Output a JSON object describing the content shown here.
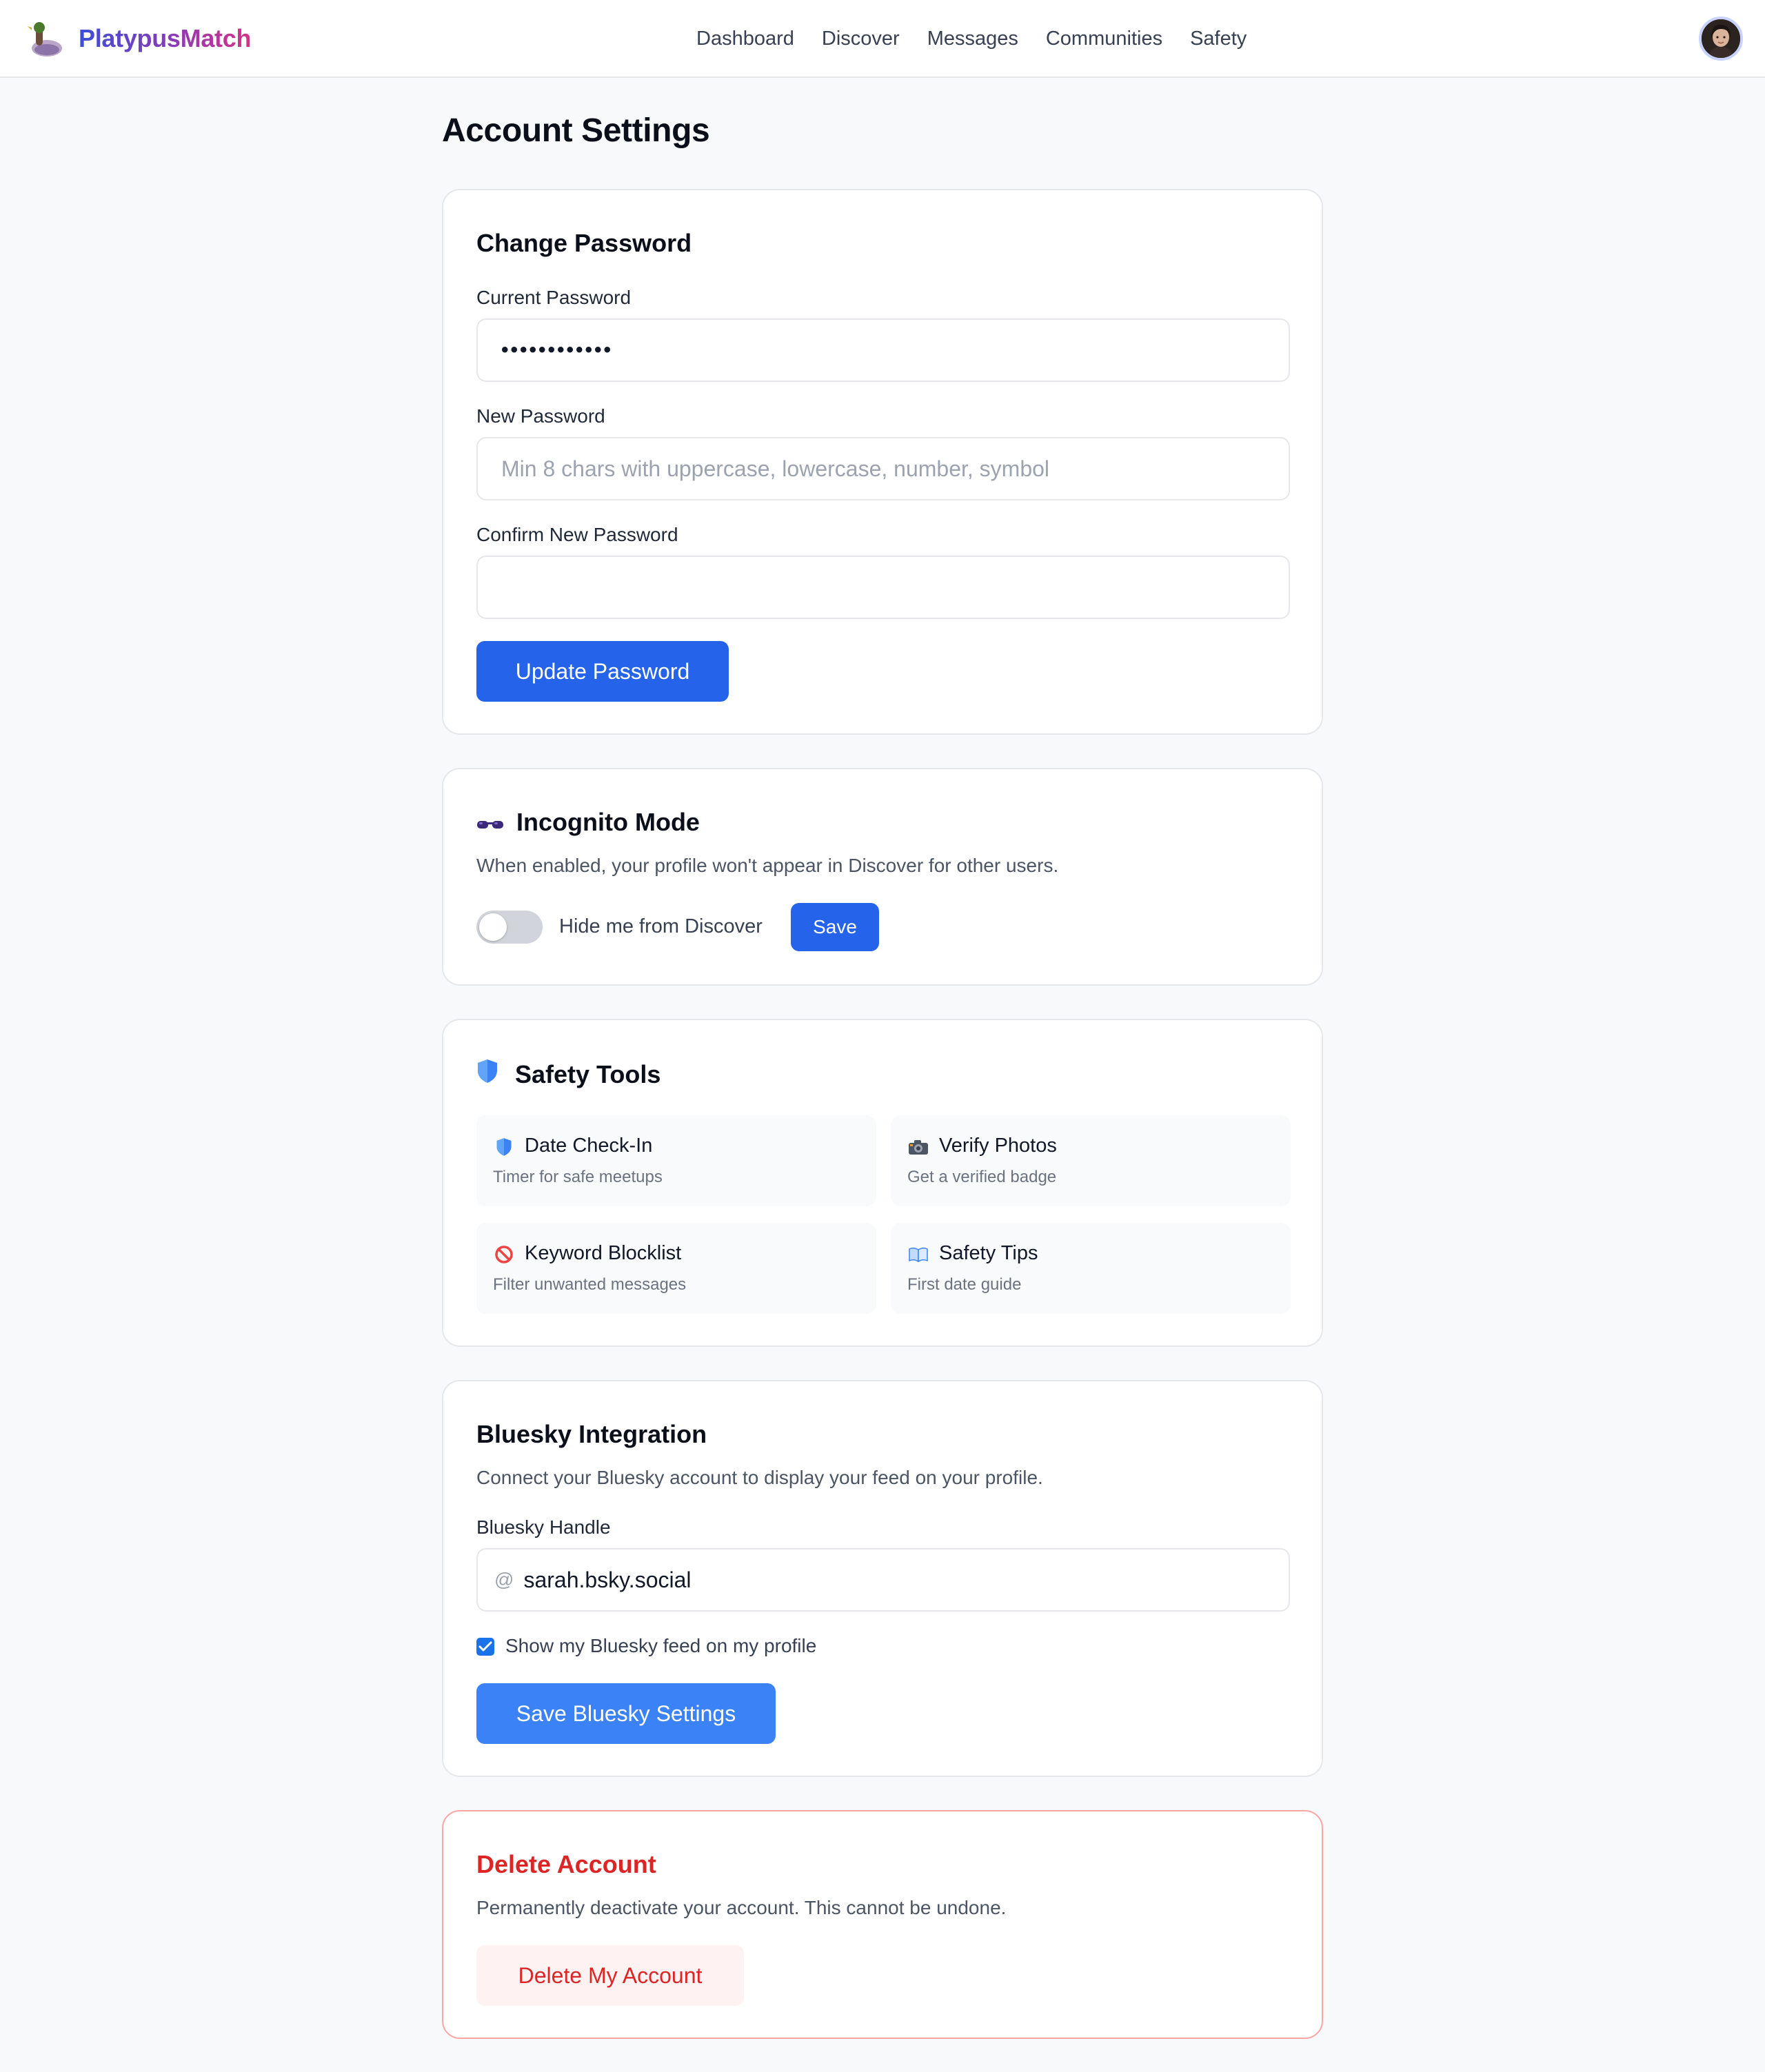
{
  "app": {
    "brand": "PlatypusMatch",
    "brand_gradient": [
      "#3b4fd6",
      "#d63384"
    ],
    "logo_icon": "platypus-duck-icon"
  },
  "nav": {
    "items": [
      "Dashboard",
      "Discover",
      "Messages",
      "Communities",
      "Safety"
    ]
  },
  "user": {
    "avatar_icon": "user-avatar"
  },
  "page": {
    "title": "Account Settings"
  },
  "change_password": {
    "title": "Change Password",
    "current_label": "Current Password",
    "current_value": "••••••••••••",
    "new_label": "New Password",
    "new_placeholder": "Min 8 chars with uppercase, lowercase, number, symbol",
    "confirm_label": "Confirm New Password",
    "confirm_value": "",
    "button": "Update Password"
  },
  "incognito": {
    "icon": "sunglasses-icon",
    "title": "Incognito Mode",
    "description": "When enabled, your profile won't appear in Discover for other users.",
    "toggle_label": "Hide me from Discover",
    "toggle_on": false,
    "button": "Save"
  },
  "safety_tools": {
    "icon": "shield-icon",
    "title": "Safety Tools",
    "tiles": [
      {
        "icon": "shield-icon",
        "title": "Date Check-In",
        "subtitle": "Timer for safe meetups"
      },
      {
        "icon": "camera-icon",
        "title": "Verify Photos",
        "subtitle": "Get a verified badge"
      },
      {
        "icon": "prohibited-icon",
        "title": "Keyword Blocklist",
        "subtitle": "Filter unwanted messages"
      },
      {
        "icon": "book-icon",
        "title": "Safety Tips",
        "subtitle": "First date guide"
      }
    ]
  },
  "bluesky": {
    "title": "Bluesky Integration",
    "description": "Connect your Bluesky account to display your feed on your profile.",
    "handle_label": "Bluesky Handle",
    "handle_prefix": "@",
    "handle_value": "sarah.bsky.social",
    "show_feed_label": "Show my Bluesky feed on my profile",
    "show_feed_checked": true,
    "button": "Save Bluesky Settings"
  },
  "delete_account": {
    "title": "Delete Account",
    "description": "Permanently deactivate your account. This cannot be undone.",
    "button": "Delete My Account"
  },
  "colors": {
    "primary": "#2563eb",
    "primary_light": "#3b82f6",
    "danger": "#dc2626",
    "danger_bg": "#fef2f2",
    "page_bg": "#f8f9fb"
  }
}
